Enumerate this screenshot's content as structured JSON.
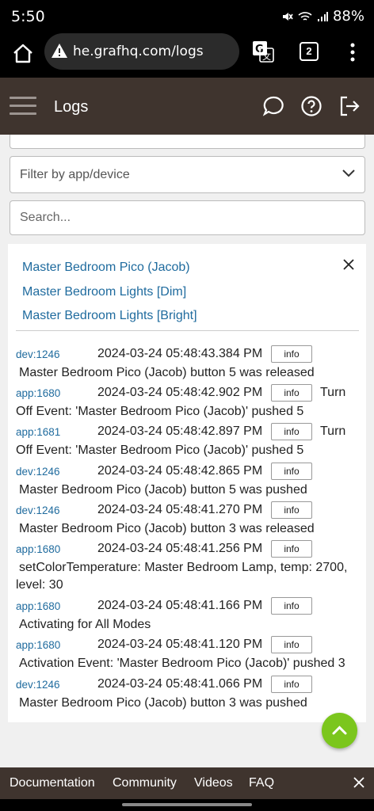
{
  "status_bar": {
    "time": "5:50",
    "battery": "88%"
  },
  "browser": {
    "url": "he.grafhq.com/logs",
    "tab_count": "2"
  },
  "header": {
    "title": "Logs"
  },
  "filters": {
    "filter_placeholder": "Filter by app/device",
    "search_placeholder": "Search..."
  },
  "selected_devices": [
    "Master Bedroom Pico (Jacob)",
    "Master Bedroom Lights [Dim]",
    "Master Bedroom Lights [Bright]"
  ],
  "logs": [
    {
      "src": "dev:1246",
      "ts": "2024-03-24 05:48:43.384 PM",
      "level": "info",
      "tail": "",
      "msg": "Master Bedroom Pico (Jacob) button 5 was released"
    },
    {
      "src": "app:1680",
      "ts": "2024-03-24 05:48:42.902 PM",
      "level": "info",
      "tail": "Turn",
      "msg": "Off Event: 'Master Bedroom Pico (Jacob)' pushed 5"
    },
    {
      "src": "app:1681",
      "ts": "2024-03-24 05:48:42.897 PM",
      "level": "info",
      "tail": "Turn",
      "msg": "Off Event: 'Master Bedroom Pico (Jacob)' pushed 5"
    },
    {
      "src": "dev:1246",
      "ts": "2024-03-24 05:48:42.865 PM",
      "level": "info",
      "tail": "",
      "msg": "Master Bedroom Pico (Jacob) button 5 was pushed"
    },
    {
      "src": "dev:1246",
      "ts": "2024-03-24 05:48:41.270 PM",
      "level": "info",
      "tail": "",
      "msg": "Master Bedroom Pico (Jacob) button 3 was released"
    },
    {
      "src": "app:1680",
      "ts": "2024-03-24 05:48:41.256 PM",
      "level": "info",
      "tail": "",
      "msg": "setColorTemperature: Master Bedroom Lamp, temp: 2700, level: 30"
    },
    {
      "src": "app:1680",
      "ts": "2024-03-24 05:48:41.166 PM",
      "level": "info",
      "tail": "",
      "msg": "Activating for All Modes"
    },
    {
      "src": "app:1680",
      "ts": "2024-03-24 05:48:41.120 PM",
      "level": "info",
      "tail": "",
      "msg": "Activation Event: 'Master Bedroom Pico (Jacob)' pushed 3"
    },
    {
      "src": "dev:1246",
      "ts": "2024-03-24 05:48:41.066 PM",
      "level": "info",
      "tail": "",
      "msg": "Master Bedroom Pico (Jacob) button 3 was pushed"
    }
  ],
  "footer": {
    "links": [
      "Documentation",
      "Community",
      "Videos",
      "FAQ"
    ]
  },
  "colors": {
    "header_bg": "#3f342e",
    "link": "#1f6b9e",
    "fab": "#7bc61d"
  },
  "icons": [
    "home-icon",
    "warning-icon",
    "translate-icon",
    "more-vert-icon",
    "menu-icon",
    "chat-icon",
    "help-icon",
    "logout-icon",
    "chevron-down-icon",
    "close-icon",
    "chevron-up-icon"
  ]
}
